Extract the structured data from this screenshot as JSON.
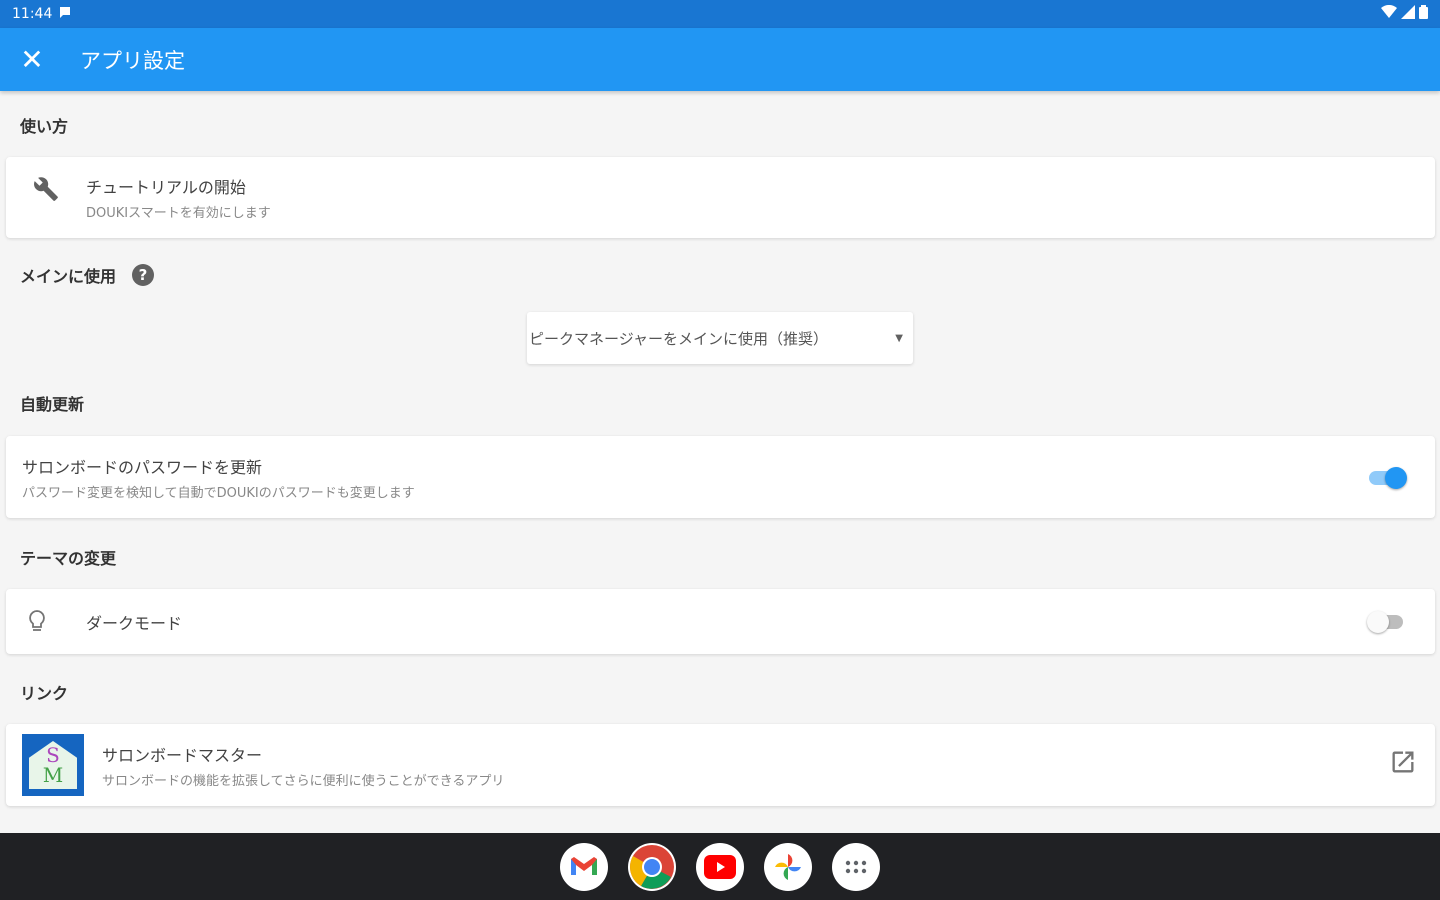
{
  "status_bar": {
    "time": "11:44"
  },
  "app_bar": {
    "close_icon": "close-icon",
    "title": "アプリ設定"
  },
  "sections": {
    "usage": {
      "header": "使い方",
      "item": {
        "title": "チュートリアルの開始",
        "subtitle": "DOUKIスマートを有効にします",
        "icon": "wrench-icon"
      }
    },
    "main_use": {
      "header": "メインに使用",
      "dropdown_value": "ピークマネージャーをメインに使用（推奨）"
    },
    "auto_update": {
      "header": "自動更新",
      "item": {
        "title": "サロンボードのパスワードを更新",
        "subtitle": "パスワード変更を検知して自動でDOUKIのパスワードも変更します",
        "enabled": true
      }
    },
    "theme": {
      "header": "テーマの変更",
      "item": {
        "title": "ダークモード",
        "enabled": false,
        "icon": "lightbulb-icon"
      }
    },
    "links": {
      "header": "リンク",
      "item": {
        "title": "サロンボードマスター",
        "subtitle": "サロンボードの機能を拡張してさらに便利に使うことができるアプリ",
        "logo_s": "S",
        "logo_m": "M"
      }
    }
  },
  "dock": [
    "gmail-icon",
    "chrome-icon",
    "youtube-icon",
    "photos-icon",
    "app-launcher-icon"
  ],
  "colors": {
    "primary": "#2196f3",
    "status_bar": "#1976d2",
    "nav_bar": "#202124"
  }
}
